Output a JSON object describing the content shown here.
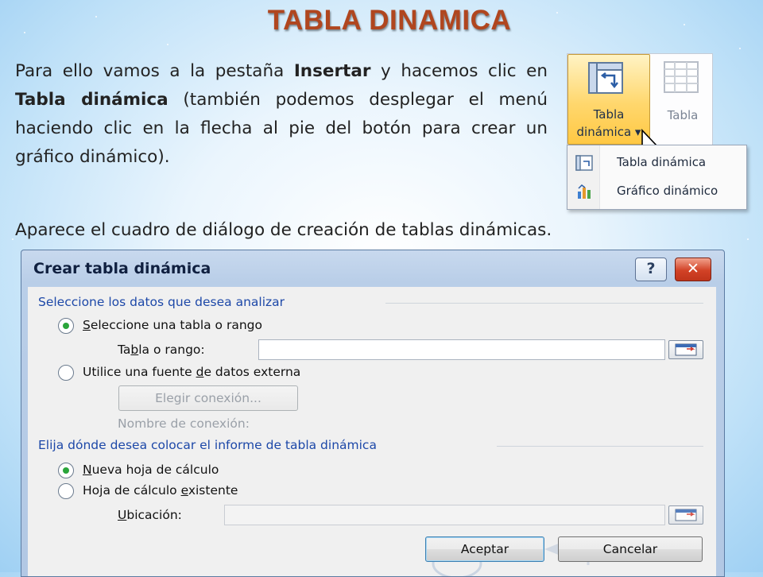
{
  "slide": {
    "title": "TABLA DINAMICA",
    "intro": {
      "p1": "Para ello vamos a la pestaña ",
      "b1": "Insertar",
      "p2": " y hacemos clic en ",
      "b2": "Tabla dinámica",
      "p3": " (también podemos desplegar el menú haciendo clic en la flecha al pie del botón para crear un gráfico dinámico)."
    },
    "second_line": "Aparece el cuadro de diálogo de creación de tablas dinámicas."
  },
  "ribbon": {
    "pivot_button": {
      "line1": "Tabla",
      "line2": "dinámica",
      "arrow": "▾",
      "icon": "pivot-table-icon"
    },
    "table_button": {
      "label": "Tabla",
      "icon": "table-icon"
    },
    "menu": [
      {
        "label": "Tabla dinámica",
        "icon": "pivot-table-small-icon"
      },
      {
        "label": "Gráfico dinámico",
        "icon": "pivot-chart-icon"
      }
    ]
  },
  "dialog": {
    "title": "Crear tabla dinámica",
    "help": "?",
    "close": "✕",
    "section1": "Seleccione los datos que desea analizar",
    "radio_range": {
      "pre": "",
      "u": "S",
      "post": "eleccione una tabla o rango",
      "selected": true
    },
    "range_label": {
      "pre": "Ta",
      "u": "b",
      "post": "la o rango:"
    },
    "range_value": "",
    "radio_external": {
      "pre": "Utilice una fuente ",
      "u": "d",
      "post": "e datos externa",
      "selected": false
    },
    "choose_connection": "Elegir conexión...",
    "connection_name": "Nombre de conexión:",
    "section2": "Elija dónde desea colocar el informe de tabla dinámica",
    "radio_new": {
      "pre": "",
      "u": "N",
      "post": "ueva hoja de cálculo",
      "selected": true
    },
    "radio_existing": {
      "pre": "Hoja de cálculo ",
      "u": "e",
      "post": "xistente",
      "selected": false
    },
    "location_label": {
      "pre": "",
      "u": "U",
      "post": "bicación:"
    },
    "location_value": "",
    "ok": "Aceptar",
    "cancel": "Cancelar"
  },
  "colors": {
    "title": "#b0461f",
    "group_header": "#1d48a8",
    "pivot_button_bg": "#ffd76d",
    "close_button": "#d24226"
  }
}
